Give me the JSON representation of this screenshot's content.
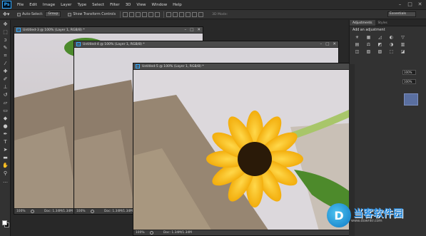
{
  "menubar": {
    "logo": "Ps",
    "items": [
      "File",
      "Edit",
      "Image",
      "Layer",
      "Type",
      "Select",
      "Filter",
      "3D",
      "View",
      "Window",
      "Help"
    ],
    "window_controls": [
      "–",
      "□",
      "✕"
    ]
  },
  "options": {
    "auto_select_label": "Auto-Select:",
    "auto_select_value": "Group",
    "transform_label": "Show Transform Controls",
    "mode_3d_label": "3D Mode:",
    "workspace": "Essentials"
  },
  "panels": {
    "tabs": [
      "Adjustments",
      "Styles"
    ],
    "add_adjustment": "Add an adjustment",
    "adj_icons": [
      "☀",
      "▦",
      "◿",
      "◐",
      "▽",
      "▤",
      "⚖",
      "◩",
      "◑",
      "▥",
      "◫",
      "▧",
      "▨",
      "⬚",
      "◪"
    ],
    "zoom_fields": [
      "100%",
      "100%"
    ]
  },
  "documents": [
    {
      "title": "Untitled-3 @ 100% (Layer 1, RGB/8) *",
      "zoom": "100%",
      "doc_info": "Doc: 1.34M/1.34M",
      "controls": [
        "–",
        "□",
        "✕"
      ]
    },
    {
      "title": "Untitled-4 @ 100% (Layer 1, RGB/8) *",
      "zoom": "100%",
      "doc_info": "Doc: 1.34M/1.34M",
      "controls": [
        "–",
        "□",
        "✕"
      ]
    },
    {
      "title": "Untitled-5 @ 100% (Layer 1, RGB/8) *",
      "zoom": "100%",
      "doc_info": "Doc: 1.34M/1.34M",
      "controls": [
        "–",
        "□",
        "✕"
      ]
    }
  ],
  "watermark": {
    "main": "当客软件园",
    "sub": "www.downkr.com",
    "logo_glyph": "D"
  },
  "colors": {
    "ps_blue": "#31a8ff",
    "sunflower": "#f5b800",
    "ui_dark": "#323232"
  }
}
